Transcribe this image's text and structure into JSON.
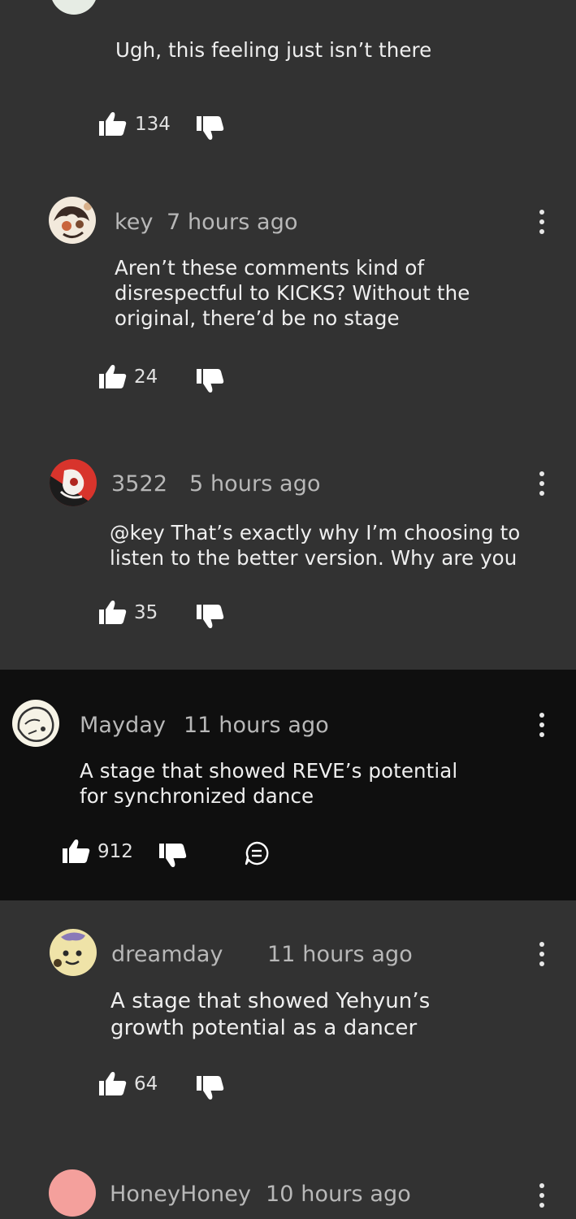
{
  "comments": [
    {
      "author": "",
      "time": "",
      "text": "Ugh, this feeling just isn’t there",
      "likes": "134"
    },
    {
      "author": "key",
      "time": "7 hours ago",
      "text": "Aren’t these comments kind of\ndisrespectful to KICKS? Without the\noriginal, there’d be no stage",
      "likes": "24"
    },
    {
      "author": "3522",
      "time": "5 hours ago",
      "text": "@key That’s exactly why I’m choosing to\nlisten to the better version. Why are you",
      "likes": "35"
    },
    {
      "author": "Mayday",
      "time": "11 hours ago",
      "text": "A stage that showed REVE’s potential\nfor synchronized dance",
      "likes": "912"
    },
    {
      "author": "dreamday",
      "time": "11 hours ago",
      "text": "A stage that showed Yehyun’s\ngrowth potential as a dancer",
      "likes": "64"
    },
    {
      "author": "HoneyHoney",
      "time": "10 hours ago",
      "text": "",
      "likes": ""
    }
  ],
  "icons": {
    "like": "thumbs-up-icon",
    "dislike": "thumbs-down-icon",
    "reply": "reply-bubble-icon",
    "more": "more-vertical-icon"
  },
  "colors": {
    "reply_background": "#323232",
    "top_comment_background": "#0f0f0f",
    "honeyhoney_avatar": "#f4a09c"
  }
}
